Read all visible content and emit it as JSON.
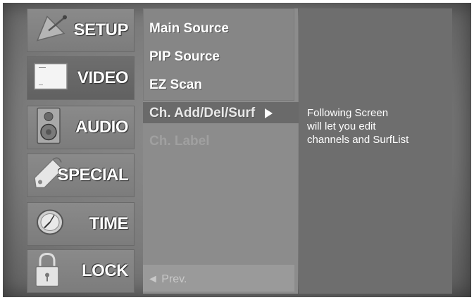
{
  "categories": [
    {
      "label": "SETUP",
      "icon": "satellite-dish-icon"
    },
    {
      "label": "VIDEO",
      "icon": "tv-screen-icon",
      "active": true
    },
    {
      "label": "AUDIO",
      "icon": "speaker-icon"
    },
    {
      "label": "SPECIAL",
      "icon": "tag-icon"
    },
    {
      "label": "TIME",
      "icon": "clock-icon"
    },
    {
      "label": "LOCK",
      "icon": "padlock-icon"
    }
  ],
  "submenu": {
    "items": [
      {
        "label": "Main Source"
      },
      {
        "label": "PIP Source"
      },
      {
        "label": "EZ Scan"
      },
      {
        "label": "Ch. Add/Del/Surf",
        "selected": true
      },
      {
        "label": "Ch. Label",
        "disabled": true
      }
    ],
    "prev_label": "◄ Prev."
  },
  "info": {
    "lines": [
      "Following Screen",
      "will let you edit",
      "channels and SurfList"
    ]
  }
}
